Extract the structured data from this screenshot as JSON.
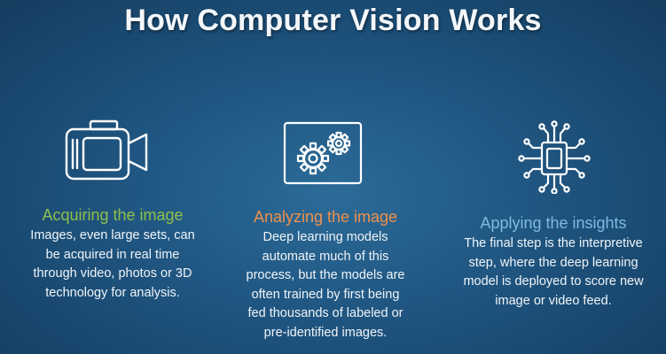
{
  "title": "How Computer Vision Works",
  "colors": {
    "acquiring": "#8fbf4c",
    "analyzing": "#f0914a",
    "applying": "#7fb9e0"
  },
  "steps": [
    {
      "icon": "camera-icon",
      "heading": "Acquiring the image",
      "lines": [
        "Images, even large sets, can",
        "be acquired in real time",
        "through video, photos or 3D",
        "technology for analysis."
      ]
    },
    {
      "icon": "gears-icon",
      "heading": "Analyzing the image",
      "lines": [
        "Deep learning models",
        "automate much of this",
        "process, but the models are",
        "often trained by first being",
        "fed thousands of labeled or",
        "pre-identified images."
      ]
    },
    {
      "icon": "chip-icon",
      "heading": "Applying the insights",
      "lines": [
        "The final step is the interpretive",
        "step, where the deep learning",
        "model is deployed to score new",
        "image or video feed."
      ]
    }
  ]
}
